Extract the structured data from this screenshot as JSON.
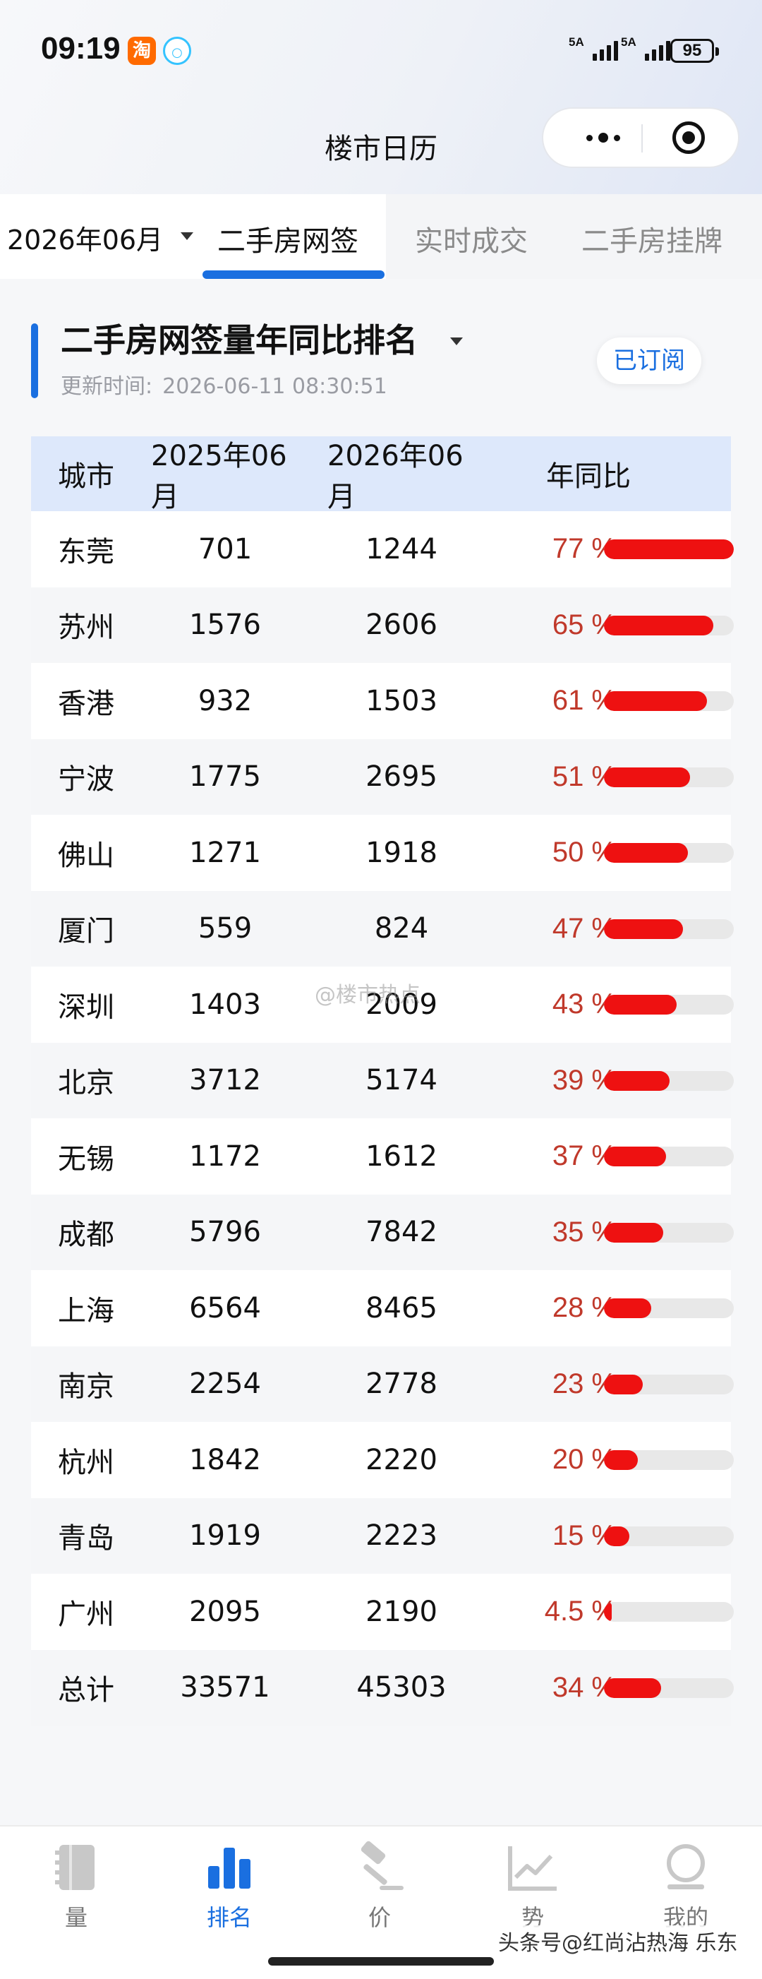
{
  "status_bar": {
    "time": "09:19",
    "app_icon_1": "淘",
    "network_1": "5A",
    "network_2": "5A",
    "battery": "95"
  },
  "navigation": {
    "title": "楼市日历"
  },
  "filters": {
    "month": "2026年06月",
    "tabs": [
      "二手房网签",
      "实时成交",
      "二手房挂牌"
    ],
    "active_tab": "二手房网签"
  },
  "section": {
    "title": "二手房网签量年同比排名",
    "update_label": "更新时间:",
    "update_time": "2026-06-11 08:30:51",
    "subscribe_label": "已订阅"
  },
  "table": {
    "headers": [
      "城市",
      "2025年06月",
      "2026年06月",
      "年同比"
    ],
    "rows": [
      {
        "city": "东莞",
        "prev": "701",
        "cur": "1244",
        "pct": "77 %",
        "ratio": 0.77
      },
      {
        "city": "苏州",
        "prev": "1576",
        "cur": "2606",
        "pct": "65 %",
        "ratio": 0.65
      },
      {
        "city": "香港",
        "prev": "932",
        "cur": "1503",
        "pct": "61 %",
        "ratio": 0.61
      },
      {
        "city": "宁波",
        "prev": "1775",
        "cur": "2695",
        "pct": "51 %",
        "ratio": 0.51
      },
      {
        "city": "佛山",
        "prev": "1271",
        "cur": "1918",
        "pct": "50 %",
        "ratio": 0.5
      },
      {
        "city": "厦门",
        "prev": "559",
        "cur": "824",
        "pct": "47 %",
        "ratio": 0.47
      },
      {
        "city": "深圳",
        "prev": "1403",
        "cur": "2009",
        "pct": "43 %",
        "ratio": 0.43
      },
      {
        "city": "北京",
        "prev": "3712",
        "cur": "5174",
        "pct": "39 %",
        "ratio": 0.39
      },
      {
        "city": "无锡",
        "prev": "1172",
        "cur": "1612",
        "pct": "37 %",
        "ratio": 0.37
      },
      {
        "city": "成都",
        "prev": "5796",
        "cur": "7842",
        "pct": "35 %",
        "ratio": 0.35
      },
      {
        "city": "上海",
        "prev": "6564",
        "cur": "8465",
        "pct": "28 %",
        "ratio": 0.28
      },
      {
        "city": "南京",
        "prev": "2254",
        "cur": "2778",
        "pct": "23 %",
        "ratio": 0.23
      },
      {
        "city": "杭州",
        "prev": "1842",
        "cur": "2220",
        "pct": "20 %",
        "ratio": 0.2
      },
      {
        "city": "青岛",
        "prev": "1919",
        "cur": "2223",
        "pct": "15 %",
        "ratio": 0.15
      },
      {
        "city": "广州",
        "prev": "2095",
        "cur": "2190",
        "pct": "4.5 %",
        "ratio": 0.045
      },
      {
        "city": "总计",
        "prev": "33571",
        "cur": "45303",
        "pct": "34 %",
        "ratio": 0.34
      }
    ],
    "bar_max": 0.77
  },
  "watermark": "@楼市热点",
  "bottom_nav": {
    "items": [
      {
        "label": "量",
        "icon": "book-icon"
      },
      {
        "label": "排名",
        "icon": "bar-chart-icon"
      },
      {
        "label": "价",
        "icon": "gavel-icon"
      },
      {
        "label": "势",
        "icon": "trend-chart-icon"
      },
      {
        "label": "我的",
        "icon": "profile-icon"
      }
    ],
    "active": "排名"
  },
  "source_label": "头条号@红尚沾热海 乐东",
  "colors": {
    "accent": "#1a6fe0",
    "bar": "#ee1111",
    "percent_text": "#c0392b",
    "header_bg": "#dde8fb"
  }
}
